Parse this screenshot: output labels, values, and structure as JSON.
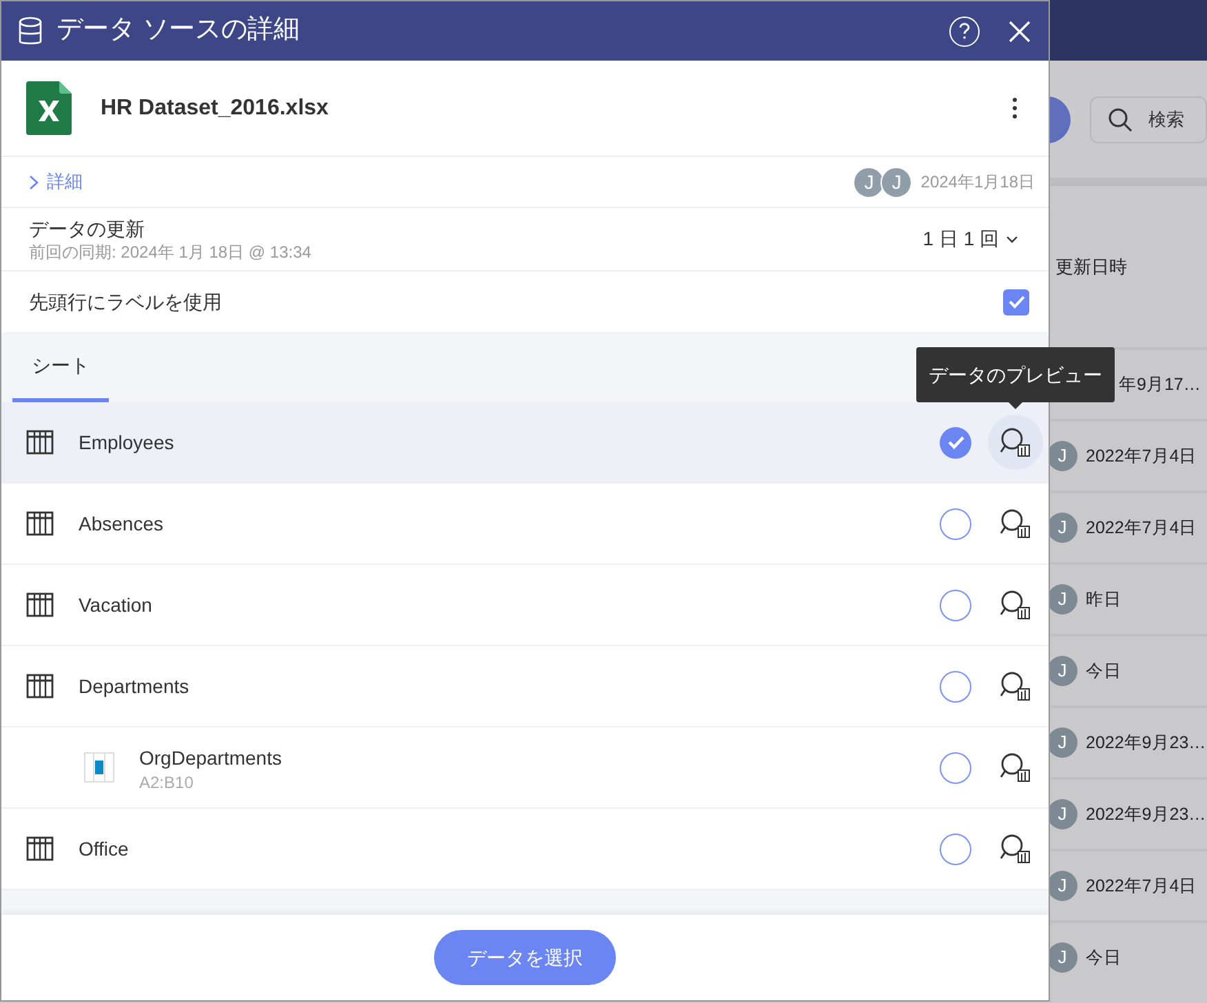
{
  "dialog": {
    "title": "データ ソースの詳細",
    "file_name": "HR Dataset_2016.xlsx",
    "details_link": "詳細",
    "owners": [
      "J",
      "J"
    ],
    "date": "2024年1月18日",
    "refresh": {
      "label": "データの更新",
      "last_sync": "前回の同期: 2024年 1月 18日 @ 13:34",
      "frequency": "1 日 1 回"
    },
    "use_header_labels": {
      "label": "先頭行にラベルを使用",
      "checked": true
    },
    "tabs": [
      {
        "label": "シート",
        "selected": true
      }
    ],
    "sheets": [
      {
        "name": "Employees",
        "selected": true,
        "tooltip": "データのプレビュー"
      },
      {
        "name": "Absences",
        "selected": false
      },
      {
        "name": "Vacation",
        "selected": false
      },
      {
        "name": "Departments",
        "selected": false,
        "children": [
          {
            "name": "OrgDepartments",
            "range": "A2:B10",
            "selected": false
          }
        ]
      },
      {
        "name": "Office",
        "selected": false
      }
    ],
    "primary_button": "データを選択"
  },
  "background": {
    "search_placeholder": "検索",
    "column_header": "更新日時",
    "rows": [
      {
        "date": "年9月17…"
      },
      {
        "avatar": "J",
        "date": "2022年7月4日"
      },
      {
        "avatar": "J",
        "date": "2022年7月4日"
      },
      {
        "avatar": "J",
        "date": "昨日"
      },
      {
        "avatar": "J",
        "date": "今日"
      },
      {
        "avatar": "J",
        "date": "2022年9月23…"
      },
      {
        "avatar": "J",
        "date": "2022年9月23…"
      },
      {
        "avatar": "J",
        "date": "2022年7月4日"
      },
      {
        "avatar": "J",
        "date": "今日"
      }
    ]
  }
}
